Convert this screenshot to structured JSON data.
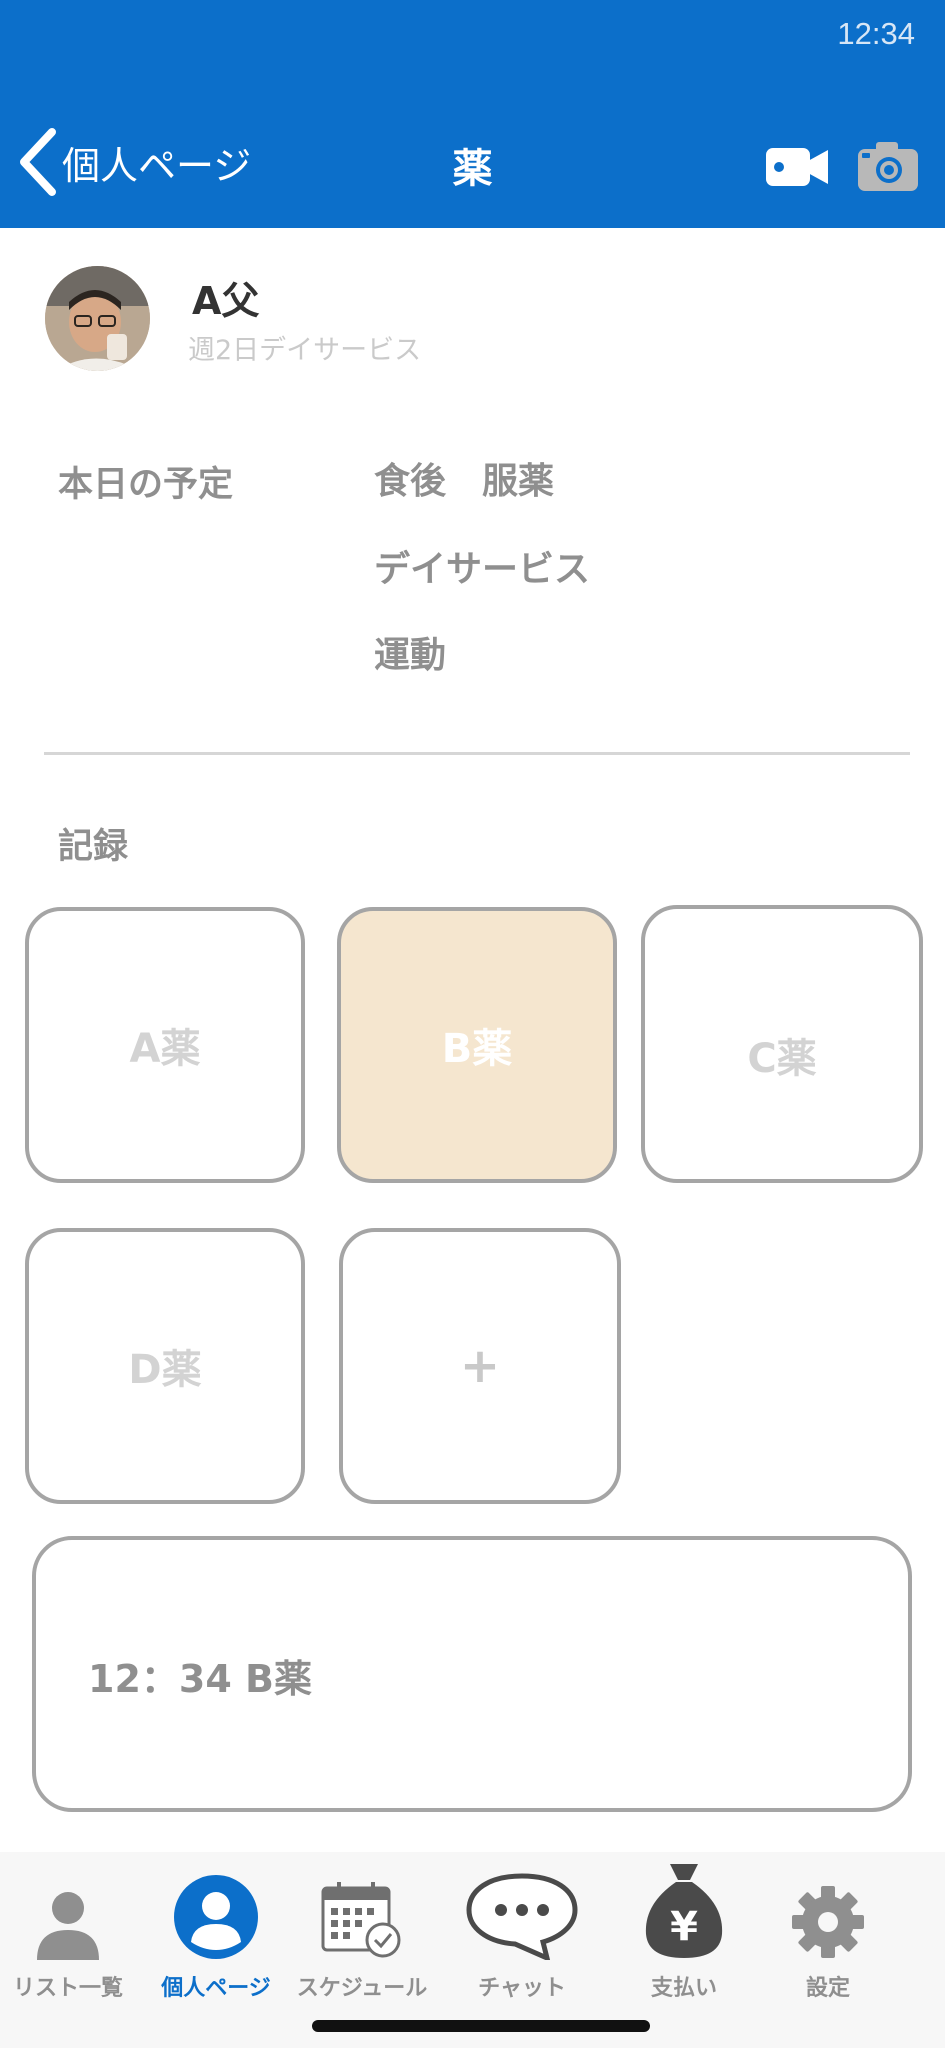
{
  "status_bar": {
    "time": "12:34"
  },
  "header": {
    "back_label": "個人ページ",
    "title": "薬"
  },
  "profile": {
    "name": "A父",
    "subtitle": "週2日デイサービス"
  },
  "schedule": {
    "label": "本日の予定",
    "items": [
      "食後　服薬",
      "デイサービス",
      "運動"
    ]
  },
  "record": {
    "label": "記録",
    "medicines": [
      {
        "label": "A薬",
        "selected": false
      },
      {
        "label": "B薬",
        "selected": true
      },
      {
        "label": "C薬",
        "selected": false
      },
      {
        "label": "D薬",
        "selected": false
      }
    ],
    "add_label": "+",
    "log_entry": "12：34 B薬"
  },
  "tabbar": {
    "tabs": [
      {
        "label": "リスト一覧",
        "icon": "person-icon",
        "active": false
      },
      {
        "label": "個人ページ",
        "icon": "person-circle-icon",
        "active": true
      },
      {
        "label": "スケジュール",
        "icon": "calendar-check-icon",
        "active": false
      },
      {
        "label": "チャット",
        "icon": "chat-bubble-icon",
        "active": false
      },
      {
        "label": "支払い",
        "icon": "yen-bag-icon",
        "active": false
      },
      {
        "label": "設定",
        "icon": "gear-icon",
        "active": false
      }
    ]
  },
  "colors": {
    "header_bg": "#0c6fca",
    "accent": "#0c6fca",
    "selected_tile": "#f5e6cf",
    "tile_border": "#a5a5a5"
  }
}
